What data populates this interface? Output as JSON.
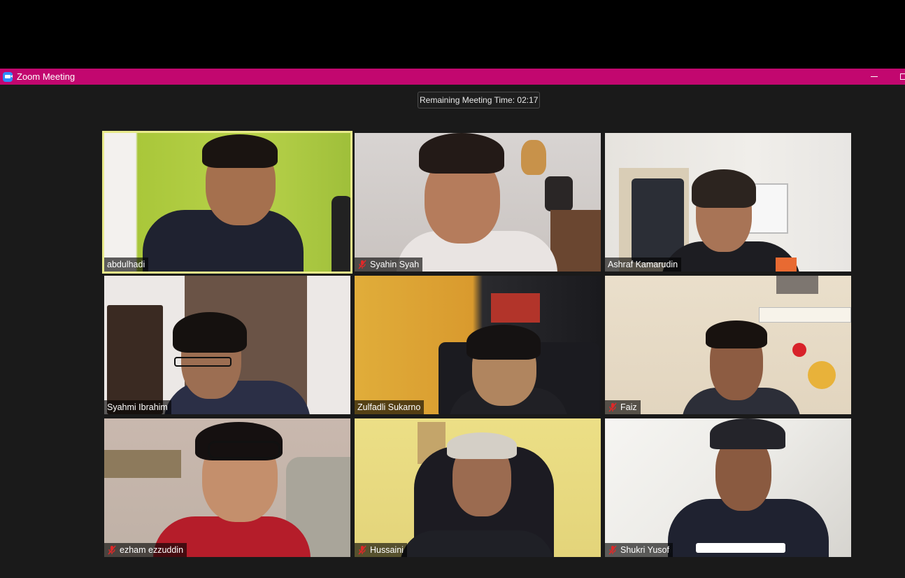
{
  "window": {
    "title": "Zoom Meeting"
  },
  "meeting": {
    "timer_text": "Remaining Meeting Time: 02:17"
  },
  "colors": {
    "titlebar": "#c2076f",
    "active_speaker_border": "#e8ea8a",
    "mute_icon": "#e02828"
  },
  "participants": [
    {
      "name": "abdulhadi",
      "muted": false,
      "active_speaker": true
    },
    {
      "name": "Syahin Syah",
      "muted": true,
      "active_speaker": false
    },
    {
      "name": "Ashraf Kamarudin",
      "muted": false,
      "active_speaker": false
    },
    {
      "name": "Syahmi Ibrahim",
      "muted": false,
      "active_speaker": false
    },
    {
      "name": "Zulfadli Sukarno",
      "muted": false,
      "active_speaker": false
    },
    {
      "name": "Faiz",
      "muted": true,
      "active_speaker": false
    },
    {
      "name": "ezham ezzuddin",
      "muted": true,
      "active_speaker": false
    },
    {
      "name": "Hussaini",
      "muted": true,
      "active_speaker": false
    },
    {
      "name": "Shukri Yusof",
      "muted": true,
      "active_speaker": false
    }
  ],
  "icons": {
    "app": "zoom-camera-icon",
    "mute": "microphone-muted-icon",
    "minimize": "minimize-icon",
    "maximize": "maximize-icon"
  }
}
